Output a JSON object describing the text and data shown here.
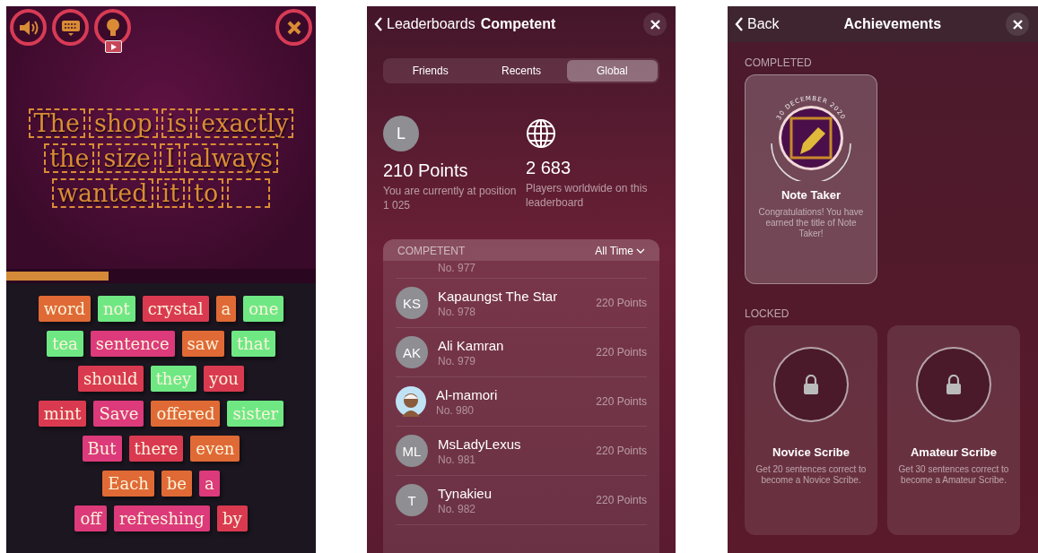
{
  "game": {
    "slots": [
      {
        "filled": true,
        "word": "The"
      },
      {
        "filled": true,
        "word": "shop"
      },
      {
        "filled": true,
        "word": "is"
      },
      {
        "filled": true,
        "word": "exactly"
      },
      {
        "filled": true,
        "word": "the"
      },
      {
        "filled": true,
        "word": "size"
      },
      {
        "filled": true,
        "word": "I"
      },
      {
        "filled": true,
        "word": "always"
      },
      {
        "filled": true,
        "word": "wanted"
      },
      {
        "filled": true,
        "word": "it"
      },
      {
        "filled": true,
        "word": "to"
      },
      {
        "filled": false
      }
    ],
    "progress": {
      "level": 0.33
    },
    "tile_rows": [
      {
        "tiles": [
          {
            "word": "word",
            "color": "#e06a35"
          },
          {
            "word": "not",
            "color": "#6fe884"
          },
          {
            "word": "crystal",
            "color": "#da3a50"
          },
          {
            "word": "a",
            "color": "#e06a35"
          },
          {
            "word": "one",
            "color": "#6fe884"
          }
        ]
      },
      {
        "tiles": [
          {
            "word": "tea",
            "color": "#6fe884"
          },
          {
            "word": "sentence",
            "color": "#dc3a7a"
          },
          {
            "word": "saw",
            "color": "#e06a35"
          },
          {
            "word": "that",
            "color": "#6fe884"
          }
        ]
      },
      {
        "tiles": [
          {
            "word": "should",
            "color": "#da3a50"
          },
          {
            "word": "they",
            "color": "#6fe884"
          },
          {
            "word": "you",
            "color": "#da3a50"
          }
        ]
      },
      {
        "tiles": [
          {
            "word": "mint",
            "color": "#da3a50"
          },
          {
            "word": "Save",
            "color": "#dc3a7a"
          },
          {
            "word": "offered",
            "color": "#e06a35"
          },
          {
            "word": "sister",
            "color": "#6fe884"
          }
        ]
      },
      {
        "tiles": [
          {
            "word": "But",
            "color": "#dc3a7a"
          },
          {
            "word": "there",
            "color": "#da3a50"
          },
          {
            "word": "even",
            "color": "#e06a35"
          }
        ]
      },
      {
        "tiles": [
          {
            "word": "Each",
            "color": "#e06a35"
          },
          {
            "word": "be",
            "color": "#e06a35"
          },
          {
            "word": "a",
            "color": "#dc3a7a"
          }
        ]
      },
      {
        "tiles": [
          {
            "word": "off",
            "color": "#dc3a7a"
          },
          {
            "word": "refreshing",
            "color": "#dc3a7a"
          },
          {
            "word": "by",
            "color": "#da3a50"
          }
        ]
      }
    ]
  },
  "leaderboard": {
    "back_label": "Leaderboards",
    "title": "Competent",
    "tabs": [
      {
        "label": "Friends",
        "selected": false
      },
      {
        "label": "Recents",
        "selected": false
      },
      {
        "label": "Global",
        "selected": true
      }
    ],
    "player": {
      "initial": "L",
      "points": "210 Points",
      "caption": "You are currently at position 1 025"
    },
    "total": {
      "count": "2 683",
      "caption": "Players worldwide on this leaderboard"
    },
    "list": {
      "section": "COMPETENT",
      "filter": "All Time"
    },
    "rows": [
      {
        "kind": "partial",
        "number": "No. 977"
      },
      {
        "kind": "initials",
        "initials": "KS",
        "name": "Kapaungst The Star",
        "number": "No. 978",
        "points": "220 Points"
      },
      {
        "kind": "initials",
        "initials": "AK",
        "name": "Ali Kamran",
        "number": "No. 979",
        "points": "220 Points"
      },
      {
        "kind": "photo",
        "name": "Al-mamori",
        "number": "No. 980",
        "points": "220 Points"
      },
      {
        "kind": "initials",
        "initials": "ML",
        "name": "MsLadyLexus",
        "number": "No. 981",
        "points": "220 Points"
      },
      {
        "kind": "initials",
        "initials": "T",
        "name": "Tynakieu",
        "number": "No. 982",
        "points": "220 Points"
      }
    ]
  },
  "achievements": {
    "back_label": "Back",
    "title": "Achievements",
    "completed": {
      "label": "COMPLETED",
      "card": {
        "date": "30 DECEMBER 2020",
        "title": "Note Taker",
        "description": "Congratulations! You have earned the title of Note Taker!"
      }
    },
    "locked": {
      "label": "LOCKED",
      "cards": [
        {
          "title": "Novice Scribe",
          "description": "Get 20 sentences correct to become a Novice Scribe."
        },
        {
          "title": "Amateur Scribe",
          "description": "Get 30 sentences correct to become a Amateur Scribe."
        }
      ]
    }
  }
}
